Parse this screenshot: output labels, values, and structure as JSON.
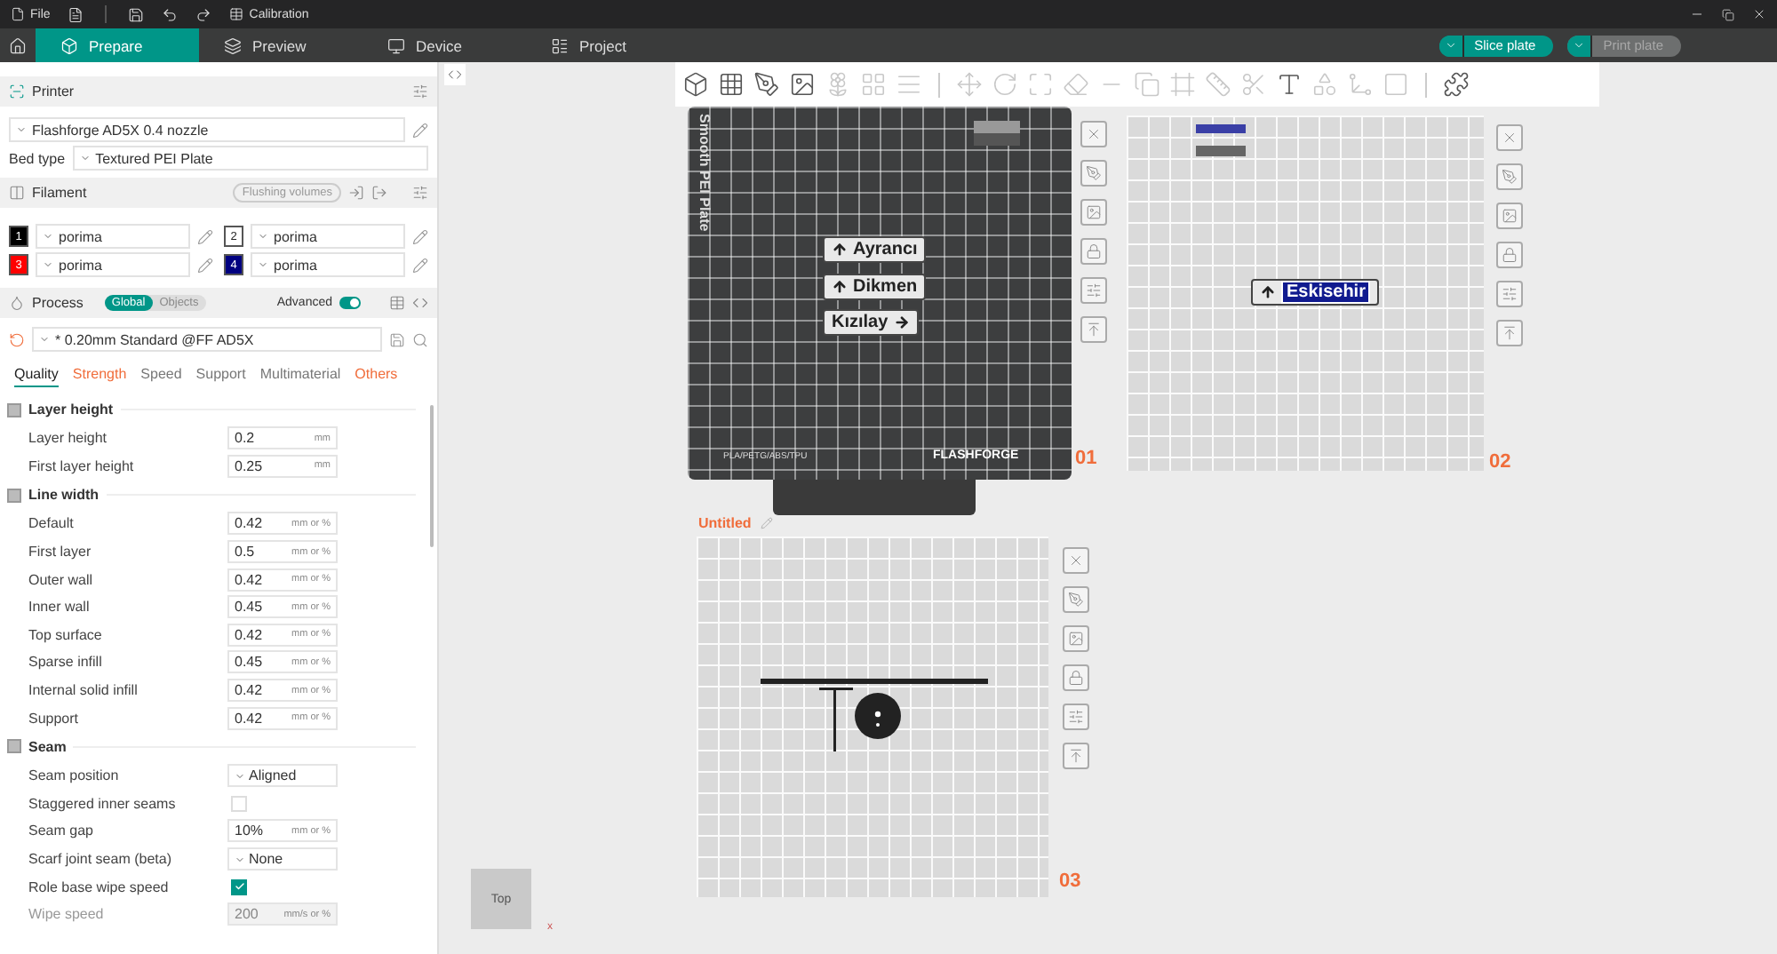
{
  "menu_bar": {
    "file": "File",
    "calibration": "Calibration"
  },
  "tabs": [
    {
      "label": "Prepare",
      "selected": true
    },
    {
      "label": "Preview",
      "selected": false
    },
    {
      "label": "Device",
      "selected": false
    },
    {
      "label": "Project",
      "selected": false
    }
  ],
  "actions": [
    {
      "label": "Slice plate",
      "disabled": false
    },
    {
      "label": "Print plate",
      "disabled": true
    }
  ],
  "printer": {
    "title": "Printer",
    "preset": "Flashforge AD5X 0.4 nozzle",
    "bed_type_label": "Bed type",
    "bed_type": "Textured PEI Plate"
  },
  "filament": {
    "title": "Filament",
    "flushing_button": "Flushing volumes",
    "slots": [
      {
        "number": "1",
        "color": "#000000",
        "name": "porima"
      },
      {
        "number": "2",
        "color": "#ffffff",
        "name": "porima"
      },
      {
        "number": "3",
        "color": "#ff0000",
        "name": "porima"
      },
      {
        "number": "4",
        "color": "#000080",
        "name": "porima"
      }
    ]
  },
  "process": {
    "title": "Process",
    "scope": [
      {
        "label": "Global",
        "selected": true
      },
      {
        "label": "Objects",
        "selected": false
      }
    ],
    "advanced_label": "Advanced",
    "advanced": true,
    "preset": "* 0.20mm Standard @FF AD5X"
  },
  "setting_tabs": [
    {
      "label": "Quality",
      "selected": true,
      "modified": false
    },
    {
      "label": "Strength",
      "selected": false,
      "modified": true
    },
    {
      "label": "Speed",
      "selected": false,
      "modified": false
    },
    {
      "label": "Support",
      "selected": false,
      "modified": false
    },
    {
      "label": "Multimaterial",
      "selected": false,
      "modified": false
    },
    {
      "label": "Others",
      "selected": false,
      "modified": true
    }
  ],
  "groups": [
    {
      "title": "Layer height",
      "rows": [
        {
          "kind": "number",
          "label": "Layer height",
          "value": "0.2",
          "unit": "mm",
          "disabled": false
        },
        {
          "kind": "number",
          "label": "First layer height",
          "value": "0.25",
          "unit": "mm",
          "disabled": false
        }
      ]
    },
    {
      "title": "Line width",
      "rows": [
        {
          "kind": "number",
          "label": "Default",
          "value": "0.42",
          "unit": "mm or %",
          "disabled": false
        },
        {
          "kind": "number",
          "label": "First layer",
          "value": "0.5",
          "unit": "mm or %",
          "disabled": false
        },
        {
          "kind": "number",
          "label": "Outer wall",
          "value": "0.42",
          "unit": "mm or %",
          "disabled": false
        },
        {
          "kind": "number",
          "label": "Inner wall",
          "value": "0.45",
          "unit": "mm or %",
          "disabled": false
        },
        {
          "kind": "number",
          "label": "Top surface",
          "value": "0.42",
          "unit": "mm or %",
          "disabled": false
        },
        {
          "kind": "number",
          "label": "Sparse infill",
          "value": "0.45",
          "unit": "mm or %",
          "disabled": false
        },
        {
          "kind": "number",
          "label": "Internal solid infill",
          "value": "0.42",
          "unit": "mm or %",
          "disabled": false
        },
        {
          "kind": "number",
          "label": "Support",
          "value": "0.42",
          "unit": "mm or %",
          "disabled": false
        }
      ]
    },
    {
      "title": "Seam",
      "rows": [
        {
          "kind": "select",
          "label": "Seam position",
          "value": "Aligned",
          "disabled": false
        },
        {
          "kind": "checkbox",
          "label": "Staggered inner seams",
          "checked": false,
          "disabled": false
        },
        {
          "kind": "number",
          "label": "Seam gap",
          "value": "10%",
          "unit": "mm or %",
          "disabled": false
        },
        {
          "kind": "select",
          "label": "Scarf joint seam (beta)",
          "value": "None",
          "disabled": false
        },
        {
          "kind": "checkbox",
          "label": "Role base wipe speed",
          "checked": true,
          "disabled": false
        },
        {
          "kind": "number",
          "label": "Wipe speed",
          "value": "200",
          "unit": "mm/s or %",
          "disabled": true
        }
      ]
    }
  ],
  "plates": [
    {
      "number": "01",
      "kind": "textured",
      "bed_name": "Smooth PEI Plate",
      "materials": "PLA/PETG/ABS/TPU",
      "brand": "FLASHFORGE",
      "signs": [
        {
          "text": "Ayrancı",
          "kind": "up"
        },
        {
          "text": "Dikmen",
          "kind": "up"
        },
        {
          "text": "Kızılay",
          "kind": "right"
        }
      ]
    },
    {
      "number": "02",
      "kind": "blank",
      "signs": [
        {
          "text": "Eskisehir",
          "kind": "highlight"
        }
      ]
    },
    {
      "number": "03",
      "kind": "blank",
      "title": "Untitled"
    }
  ],
  "view_cube": {
    "face": "Top",
    "axis": "x"
  }
}
